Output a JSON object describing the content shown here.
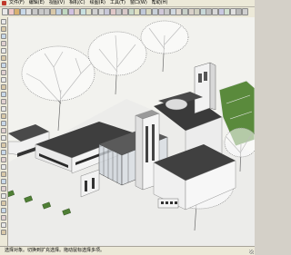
{
  "menubar": {
    "items": [
      "文件(F)",
      "编辑(E)",
      "视图(V)",
      "相机(C)",
      "绘图(R)",
      "工具(T)",
      "窗口(W)",
      "帮助(H)"
    ]
  },
  "toolbar": {
    "tools": [
      "select",
      "eraser",
      "paint",
      "rectangle",
      "line",
      "circle",
      "arc",
      "polygon",
      "freehand",
      "push-pull",
      "follow-me",
      "move",
      "rotate",
      "scale",
      "offset",
      "tape-measure",
      "dimension",
      "protractor",
      "text",
      "axes",
      "3d-text",
      "orbit",
      "pan",
      "zoom",
      "zoom-window",
      "zoom-extents",
      "previous-view",
      "iso-view",
      "top-view",
      "front-view",
      "right-view",
      "back-view",
      "left-view",
      "xray",
      "wireframe",
      "hidden-line",
      "shaded",
      "textured",
      "monochrome",
      "shadows",
      "fog"
    ],
    "tool_colors": [
      "#e8e8e8",
      "#f0c8c8",
      "#d8b070",
      "#c8d8e8",
      "#e0e0e0",
      "#c8c8c8",
      "#c8c8c8",
      "#c8c8c8",
      "#d8c8a8",
      "#c0d0e0",
      "#c0d8c0",
      "#d0c0e0",
      "#e0d0c0",
      "#c8e0e0",
      "#e0e0c8",
      "#d0d0d0",
      "#d8d8d8",
      "#c8c8d8",
      "#e0c8c8",
      "#c8c8c8",
      "#d8c8c8",
      "#c8d8c8",
      "#e0e0c0",
      "#c0c8d8",
      "#d8d8c0",
      "#c8d0d8",
      "#d0c8d8",
      "#c8c8c8",
      "#d0d8e0",
      "#e0d8d0",
      "#c8d0c8",
      "#d8d0c8",
      "#d0d0c0",
      "#c8d8d8",
      "#c0c0c0",
      "#d8d8d8",
      "#c8c8e0",
      "#d0e0d0",
      "#e0e0e0",
      "#b8b8b8",
      "#d0d0d0"
    ]
  },
  "sidebar": {
    "tools": [
      "select",
      "component",
      "paint",
      "eraser",
      "rectangle",
      "line",
      "circle",
      "arc",
      "polygon",
      "freehand",
      "move",
      "push-pull",
      "rotate",
      "follow-me",
      "scale",
      "offset",
      "tape-measure",
      "dimension",
      "protractor",
      "text",
      "axes",
      "3d-text",
      "orbit",
      "pan",
      "zoom",
      "zoom-extents",
      "position-camera",
      "walk",
      "look-around",
      "section-plane"
    ]
  },
  "statusbar": {
    "text": "选择对象。切换到扩充选择。拖动鼠标选择多项。"
  },
  "colors": {
    "chrome": "#d4d0c8",
    "sky": "#f2f2ee",
    "roof_dark": "#3e3e3e",
    "wall_white": "#f4f4f4",
    "grass": "#5a8a3c"
  }
}
